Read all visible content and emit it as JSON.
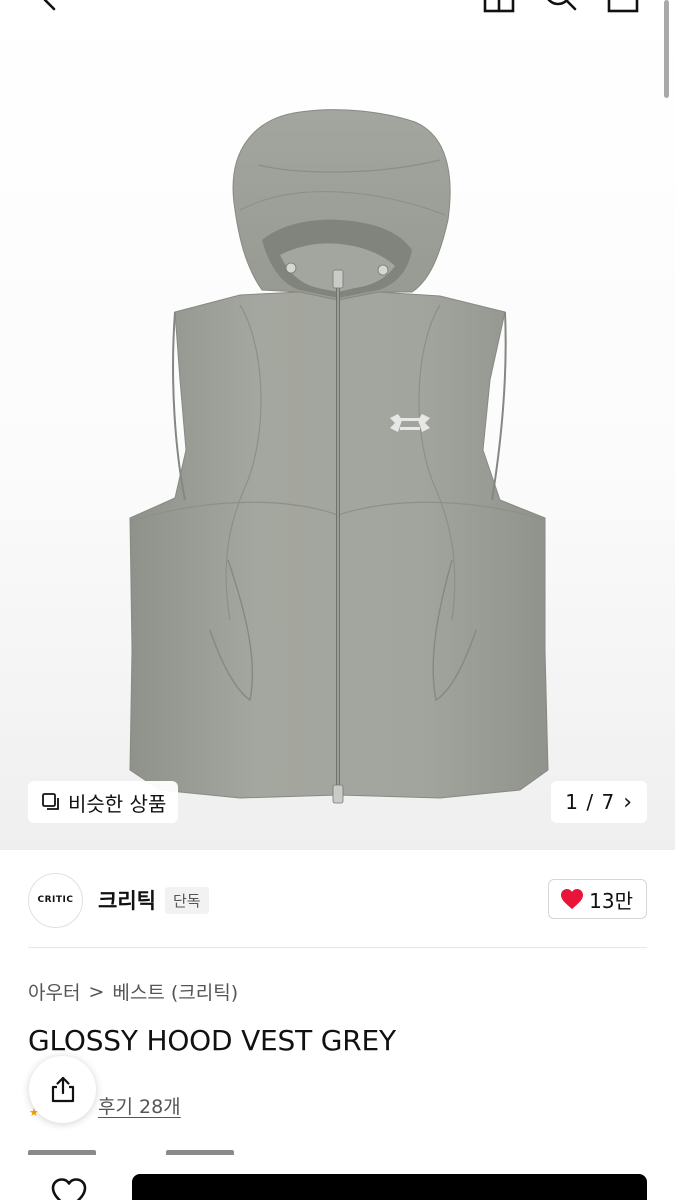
{
  "hero": {
    "similar_button_label": "비슷한 상품",
    "pager_text": "1 / 7",
    "pager_arrow": "›"
  },
  "brand": {
    "logo_text": "CRITIC",
    "name": "크리틱",
    "badge": "단독"
  },
  "likes": {
    "count": "13만",
    "color": "#e8143a"
  },
  "breadcrumb": {
    "category": "아우터",
    "separator": ">",
    "subcategory": "베스트 (크리틱)"
  },
  "product": {
    "title": "GLOSSY HOOD VEST GREY"
  },
  "reviews": {
    "link_label": "후기 28개"
  },
  "icons": {
    "back": "back-chevron-icon",
    "cart": "cart-icon",
    "search": "search-icon",
    "bag": "bag-icon",
    "share": "share-icon",
    "heart": "heart-icon",
    "similar": "similar-items-icon"
  }
}
